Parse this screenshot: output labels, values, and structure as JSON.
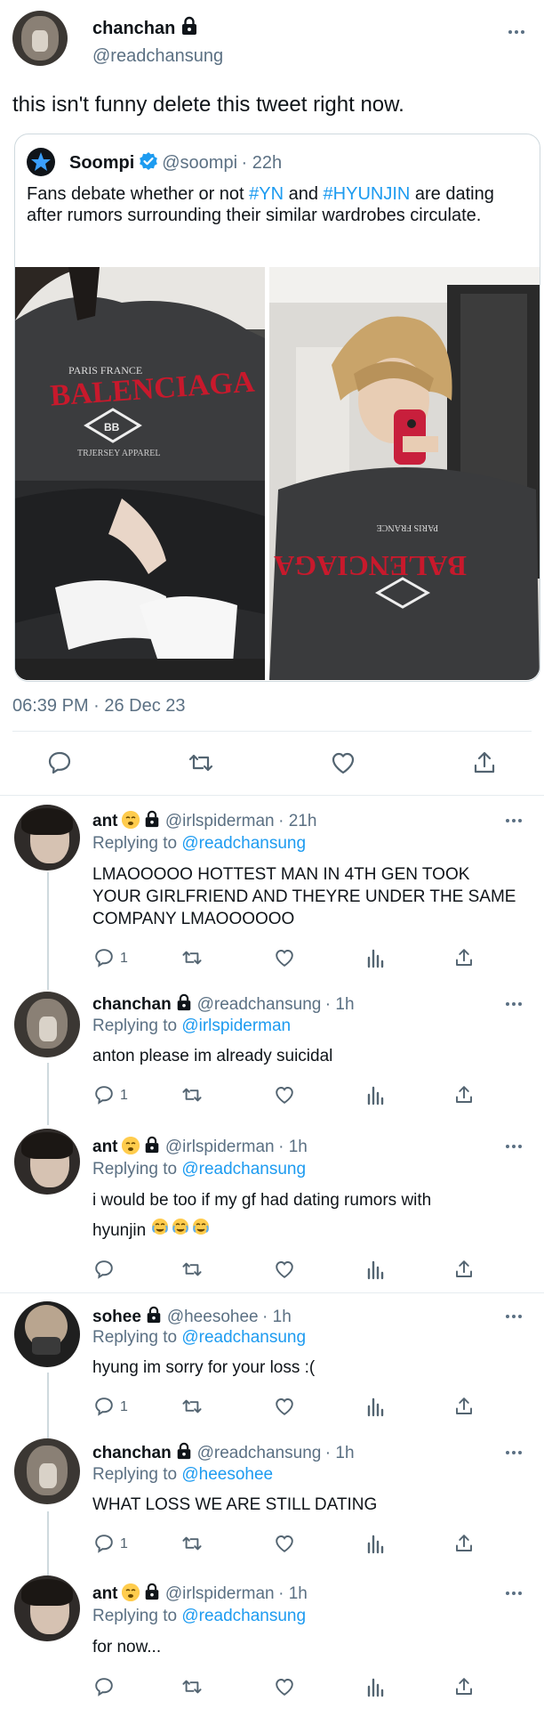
{
  "main_tweet": {
    "author_name": "chanchan",
    "author_handle": "@readchansung",
    "text": "this isn't funny delete this tweet right now.",
    "timestamp": "06:39 PM · 26 Dec 23",
    "more_icon": "more-horizontal-icon"
  },
  "quoted_tweet": {
    "author_name": "Soompi",
    "author_handle": "@soompi",
    "time": "· 22h",
    "text_part1": "Fans debate whether or not ",
    "hashtag1": "#YN",
    "text_part2": " and ",
    "hashtag2": "#HYUNJIN",
    "text_part3": " are dating after rumors surrounding their similar wardrobes circulate.",
    "verified_color": "#1d9bf0"
  },
  "actions": {
    "reply_icon": "reply-icon",
    "retweet_icon": "retweet-icon",
    "like_icon": "heart-icon",
    "share_icon": "share-icon"
  },
  "replies": [
    {
      "name": "ant",
      "handle": "@irlspiderman",
      "time": "· 21h",
      "replying_prefix": "Replying to ",
      "replying_to": "@readchansung",
      "text": "LMAOOOOO HOTTEST MAN IN 4TH GEN TOOK YOUR GIRLFRIEND AND THEYRE UNDER THE SAME COMPANY LMAOOOOOO",
      "reply_count": "1"
    },
    {
      "name": "chanchan",
      "handle": "@readchansung",
      "time": "· 1h",
      "replying_prefix": "Replying to ",
      "replying_to": "@irlspiderman",
      "text": "anton please im already suicidal",
      "reply_count": "1"
    },
    {
      "name": "ant",
      "handle": "@irlspiderman",
      "time": "· 1h",
      "replying_prefix": "Replying to ",
      "replying_to": "@readchansung",
      "text_line1": "i would be too if my gf had dating rumors with",
      "text_line2": "hyunjin",
      "reply_count": ""
    },
    {
      "name": "sohee",
      "handle": "@heesohee",
      "time": "· 1h",
      "replying_prefix": "Replying to ",
      "replying_to": "@readchansung",
      "text": "hyung im sorry for your loss :(",
      "reply_count": "1"
    },
    {
      "name": "chanchan",
      "handle": "@readchansung",
      "time": "· 1h",
      "replying_prefix": "Replying to ",
      "replying_to": "@heesohee",
      "text": "WHAT LOSS WE ARE STILL DATING",
      "reply_count": "1"
    },
    {
      "name": "ant",
      "handle": "@irlspiderman",
      "time": "· 1h",
      "replying_prefix": "Replying to ",
      "replying_to": "@readchansung",
      "text": "for now...",
      "reply_count": ""
    }
  ],
  "colors": {
    "link": "#1d9bf0",
    "secondary_text": "#5b7083",
    "border": "#cfd9de"
  }
}
